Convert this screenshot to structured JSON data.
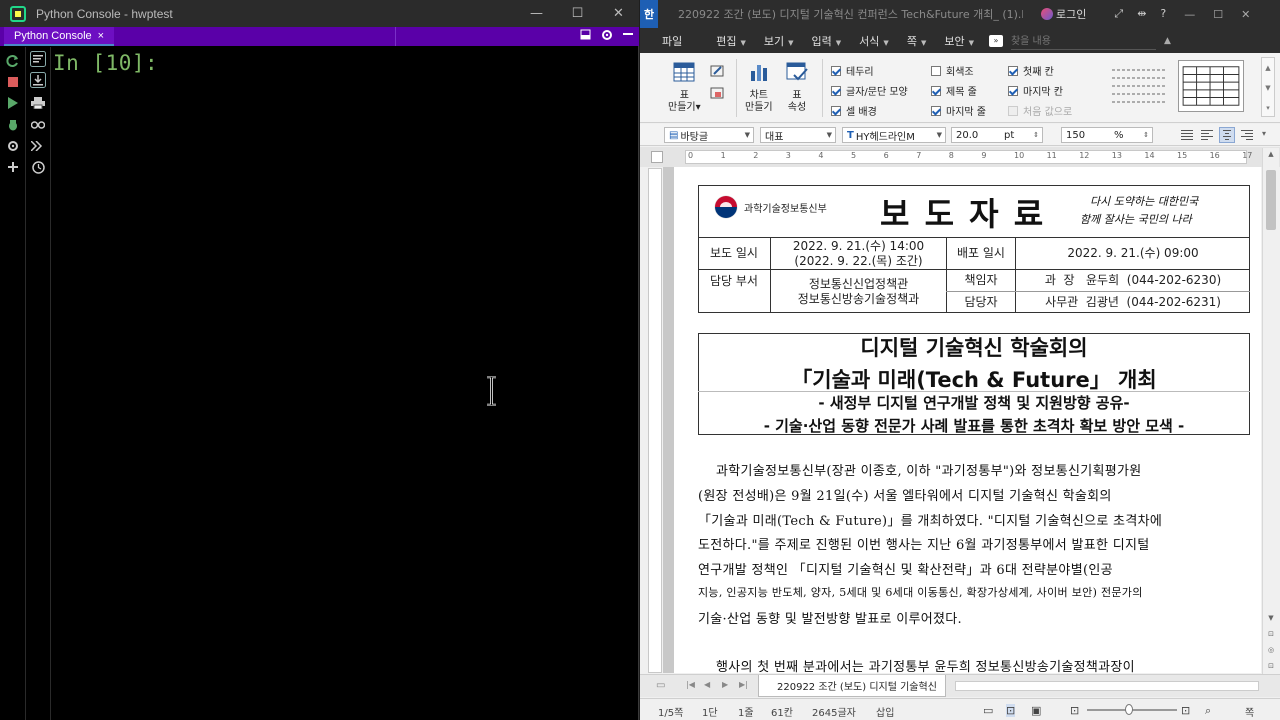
{
  "python_console": {
    "window_title": "Python Console - hwptest",
    "tab_label": "Python Console",
    "tab_close": "×",
    "prompt": "In [10]:",
    "winbtns": {
      "minimize": "—",
      "maximize": "☐",
      "close": "✕"
    }
  },
  "hwp": {
    "app_logo": "한",
    "doc_title": "220922 조간 (보도) 디지털 기술혁신 컨퍼런스 Tech&Future 개최_ (1).h...",
    "login": "로그인",
    "menu": {
      "file": "파일",
      "items": [
        "편집",
        "보기",
        "입력",
        "서식",
        "쪽",
        "보안"
      ],
      "search_placeholder": "찾을 내용"
    },
    "ribbon": {
      "table_make": [
        "표",
        "만들기"
      ],
      "chart_make": [
        "차트",
        "만들기"
      ],
      "table_props": [
        "표",
        "속성"
      ],
      "checks": [
        {
          "label": "테두리",
          "on": true
        },
        {
          "label": "글자/문단 모양",
          "on": true
        },
        {
          "label": "셀 배경",
          "on": true
        },
        {
          "label": "회색조",
          "on": false
        },
        {
          "label": "제목 줄",
          "on": true
        },
        {
          "label": "마지막 줄",
          "on": true
        },
        {
          "label": "첫째 칸",
          "on": true
        },
        {
          "label": "마지막 칸",
          "on": true
        },
        {
          "label": "처음 값으로",
          "on": false
        }
      ]
    },
    "format": {
      "style": "바탕글",
      "lang": "대표",
      "font": "HY헤드라인M",
      "size": "20.0",
      "size_unit": "pt",
      "zoom": "150",
      "zoom_unit": "%"
    },
    "ruler_ticks": [
      "0",
      "1",
      "2",
      "3",
      "4",
      "5",
      "6",
      "7",
      "8",
      "9",
      "10",
      "11",
      "12",
      "13",
      "14",
      "15",
      "16",
      "17"
    ],
    "document": {
      "ministry": "과학기술정보통신부",
      "press_title": "보 도 자 료",
      "slogan_line1": "다시 도약하는 대한민국",
      "slogan_line2": "함께 잘사는 국민의 나라",
      "row1": {
        "label1": "보도 일시",
        "value1_line1": "2022. 9. 21.(수) 14:00",
        "value1_line2": "(2022. 9. 22.(목) 조간)",
        "label2": "배포 일시",
        "value2": "2022. 9. 21.(수) 09:00"
      },
      "row2": {
        "label1": "담당 부서",
        "dept_line1": "정보통신신업정책관",
        "dept_line2": "정보통신방송기술정책과",
        "resp_label": "책임자",
        "resp_value": "과  장   윤두희  (044-202-6230)",
        "staff_label": "담당자",
        "staff_value": "사무관  김광년  (044-202-6231)"
      },
      "headline1": "디지털 기술혁신 학술회의",
      "headline2": "「기술과 미래(Tech & Future」 개최",
      "sub1": "- 새정부 디지털 연구개발 정책 및 지원방향 공유-",
      "sub2": "- 기술·산업 동향 전문가 사례 발표를 통한 초격차 확보 방안 모색 -",
      "body": [
        "과학기술정보통신부(장관 이종호, 이하 \"과기정통부\")와 정보통신기획평가원",
        "(원장 전성배)은 9월 21일(수) 서울 엘타워에서 디지털 기술혁신 학술회의",
        "「기술과 미래(Tech & Future)」를 개최하였다. \"디지털 기술혁신으로 초격차에",
        "도전하다.\"를 주제로 진행된 이번 행사는 지난 6월 과기정통부에서 발표한 디지털",
        "연구개발 정책인 「디지털 기술혁신 및 확산전략」과 6대 전략분야별(인공",
        "지능, 인공지능 반도체, 양자, 5세대 및 6세대 이동통신, 확장가상세계, 사이버 보안) 전문가의",
        "기술·산업 동향 및 발전방향 발표로 이루어졌다."
      ],
      "next_line": "행사의 첫 번째 분과에서는 과기정통부 윤두희 정보통신방송기술정책과장이"
    },
    "doc_tab": "220922 조간 (보도) 디지털 기술혁신",
    "status": {
      "page": "1/5쪽",
      "section": "1단",
      "line": "1줄",
      "col": "61칸",
      "chars": "2645글자",
      "mode": "삽입",
      "zoom_label": "쪽"
    }
  }
}
